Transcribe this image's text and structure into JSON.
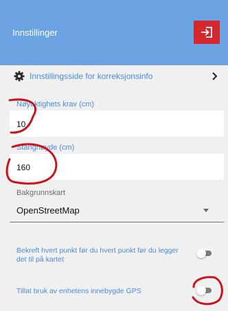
{
  "header": {
    "title": "Innstillinger",
    "exit_icon": "logout-icon",
    "accent": "#6aa2e2",
    "exit_color": "#d4282e"
  },
  "settings_link": {
    "icon": "gear-icon",
    "label": "Innstillingsside for korreksjonsinfo"
  },
  "accuracy": {
    "label": "Nøyaktighets krav (cm)",
    "value": "10"
  },
  "pole_height": {
    "label": "Stanghøyde (cm)",
    "value": "160"
  },
  "background_map": {
    "label": "Bakgrunnskart",
    "selected": "OpenStreetMap"
  },
  "toggles": [
    {
      "label": "Bekreft hvert punkt før du hvert punkt før du legger det til på kartet",
      "on": false
    },
    {
      "label": "Tillat bruk av enhetens innebygde GPS",
      "on": false
    }
  ]
}
